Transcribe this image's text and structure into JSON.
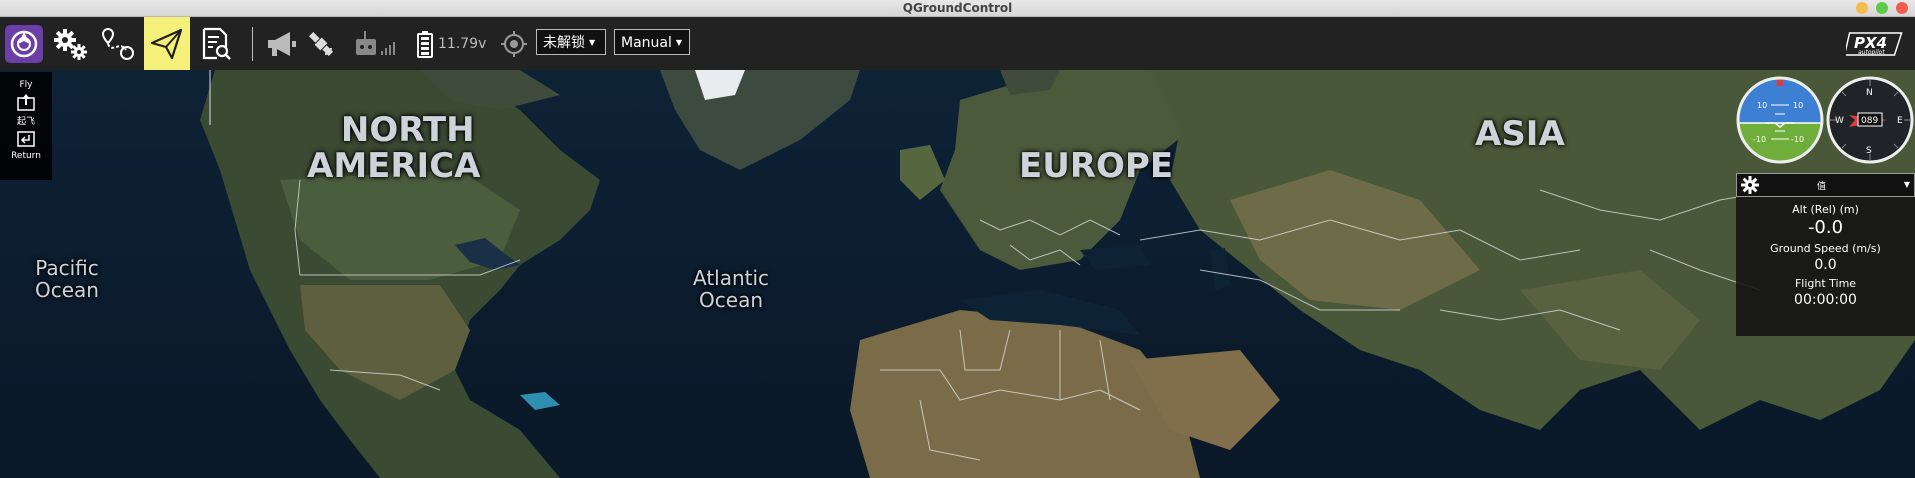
{
  "window": {
    "title": "QGroundControl"
  },
  "toolbar": {
    "battery_voltage": "11.79v",
    "arm_status": "未解锁",
    "flight_mode": "Manual",
    "brand_logo": "PX4 autopilot"
  },
  "flyrail": {
    "title": "Fly",
    "takeoff_label": "起飞",
    "return_label": "Return"
  },
  "map_labels": {
    "north_america": [
      "NORTH",
      "AMERICA"
    ],
    "europe": "EUROPE",
    "asia": "ASIA",
    "pacific": [
      "Pacific",
      "Ocean"
    ],
    "atlantic": [
      "Atlantic",
      "Ocean"
    ]
  },
  "compass": {
    "heading": "089",
    "n": "N",
    "e": "E",
    "s": "S",
    "w": "W"
  },
  "attitude": {
    "pitch_up": "10",
    "pitch_down": "-10"
  },
  "values_panel": {
    "selector_label": "值",
    "alt_label": "Alt (Rel) (m)",
    "alt_value": "-0.0",
    "speed_label": "Ground Speed (m/s)",
    "speed_value": "0.0",
    "time_label": "Flight Time",
    "time_value": "00:00:00"
  },
  "colors": {
    "toolbar_bg": "#222222",
    "active_tool": "#f5f07a",
    "qgc_icon": "#6c3fa8",
    "sky": "#3d7fd3",
    "ground": "#6fae3a"
  }
}
